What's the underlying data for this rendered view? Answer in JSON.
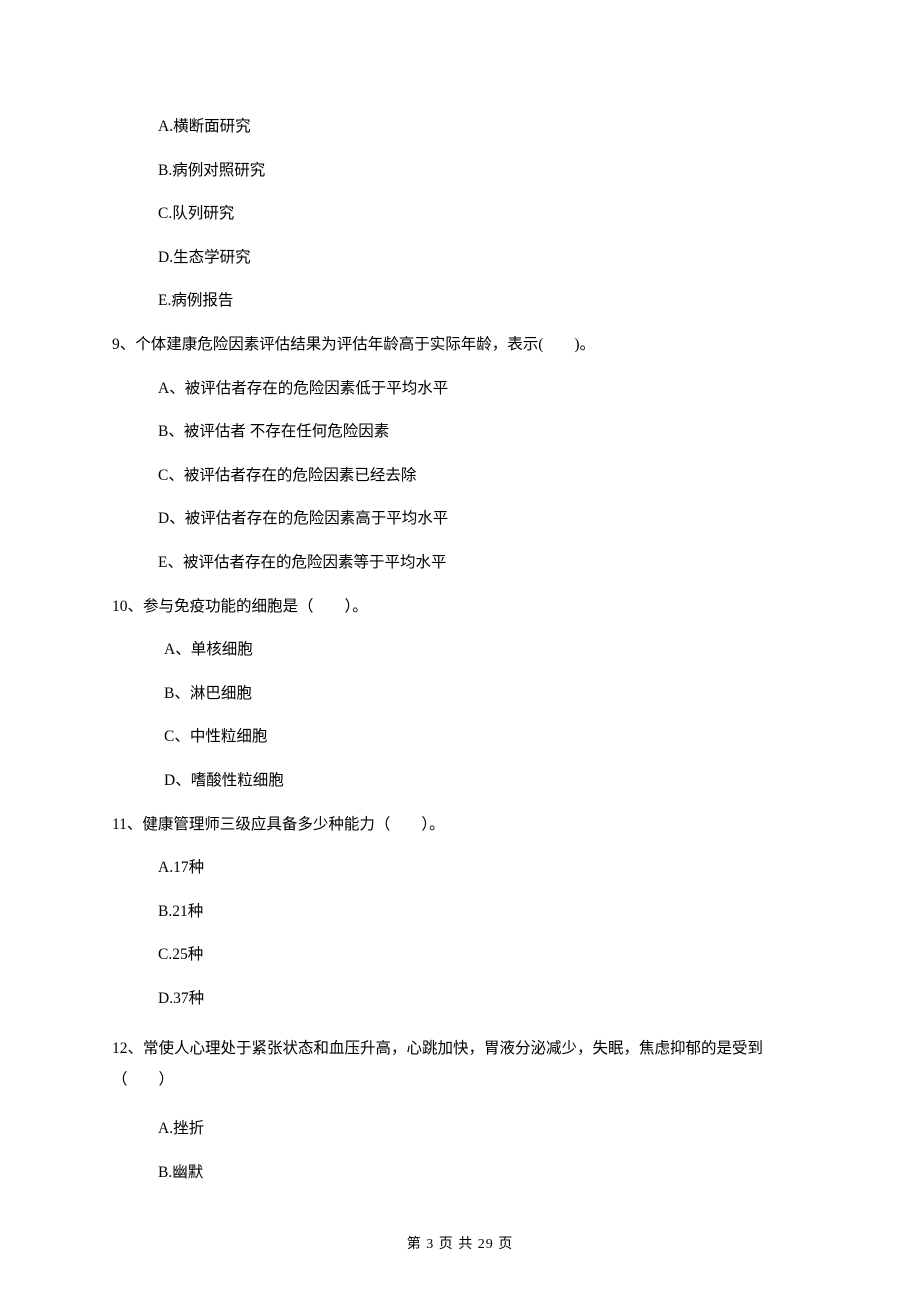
{
  "q8_options": {
    "a": "A.横断面研究",
    "b": "B.病例对照研究",
    "c": "C.队列研究",
    "d": "D.生态学研究",
    "e": "E.病例报告"
  },
  "q9": {
    "stem": "9、个体建康危险因素评估结果为评估年龄高于实际年龄，表示(　　)。",
    "a": "A、被评估者存在的危险因素低于平均水平",
    "b": "B、被评估者 不存在任何危险因素",
    "c": "C、被评估者存在的危险因素已经去除",
    "d": "D、被评估者存在的危险因素高于平均水平",
    "e": "E、被评估者存在的危险因素等于平均水平"
  },
  "q10": {
    "stem": "10、参与免疫功能的细胞是（　　）。",
    "a": "A、单核细胞",
    "b": "B、淋巴细胞",
    "c": "C、中性粒细胞",
    "d": "D、嗜酸性粒细胞"
  },
  "q11": {
    "stem": "11、健康管理师三级应具备多少种能力（　　）。",
    "a": "A.17种",
    "b": "B.21种",
    "c": "C.25种",
    "d": "D.37种"
  },
  "q12": {
    "stem": "12、常使人心理处于紧张状态和血压升高，心跳加快，胃液分泌减少，失眠，焦虑抑郁的是受到（　　）",
    "a": "A.挫折",
    "b": "B.幽默"
  },
  "footer": "第 3 页 共 29 页"
}
